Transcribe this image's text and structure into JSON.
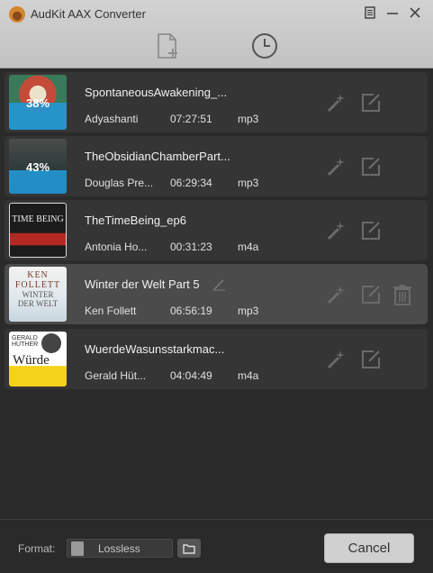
{
  "app": {
    "title": "AudKit AAX Converter"
  },
  "books": [
    {
      "title": "SpontaneousAwakening_...",
      "author": "Adyashanti",
      "duration": "07:27:51",
      "format": "mp3",
      "progress_label": "38%",
      "progress": 0.38
    },
    {
      "title": "TheObsidianChamberPart...",
      "author": "Douglas Pre...",
      "duration": "06:29:34",
      "format": "mp3",
      "progress_label": "43%",
      "progress": 0.43
    },
    {
      "title": "TheTimeBeing_ep6",
      "author": "Antonia Ho...",
      "duration": "00:31:23",
      "format": "m4a"
    },
    {
      "title": "Winter der Welt Part 5",
      "author": "Ken Follett",
      "duration": "06:56:19",
      "format": "mp3"
    },
    {
      "title": "WuerdeWasunsstarkmac...",
      "author": "Gerald Hüt...",
      "duration": "04:04:49",
      "format": "m4a"
    }
  ],
  "covers": {
    "time_being": {
      "line1": "TIME BEING"
    },
    "ken_follett": {
      "author": "KEN FOLLETT",
      "title": "WINTER DER WELT"
    },
    "wuerde": {
      "author": "GERALD HÜTHER",
      "title": "Würde"
    }
  },
  "footer": {
    "format_label": "Format:",
    "format_value": "Lossless",
    "cancel_label": "Cancel"
  },
  "colors": {
    "progress": "#2396d2",
    "row_bg": "#353535",
    "row_hover_bg": "#4b4b4b",
    "titlebar": "#c8c8c8"
  }
}
